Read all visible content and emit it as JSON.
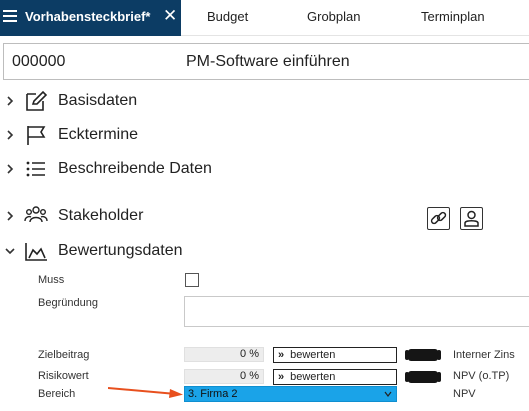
{
  "tabs": {
    "active": "Vorhabensteckbrief*",
    "items": [
      "Budget",
      "Grobplan",
      "Terminplan"
    ]
  },
  "header": {
    "id": "000000",
    "name": "PM-Software einführen"
  },
  "sections": {
    "basisdaten": "Basisdaten",
    "ecktermine": "Ecktermine",
    "beschreibende": "Beschreibende Daten",
    "stakeholder": "Stakeholder",
    "bewertung": "Bewertungsdaten"
  },
  "form": {
    "muss_label": "Muss",
    "begruendung_label": "Begründung",
    "zielbeitrag_label": "Zielbeitrag",
    "zielbeitrag_value": "0 %",
    "risikowert_label": "Risikowert",
    "risikowert_value": "0 %",
    "bereich_label": "Bereich",
    "bereich_value": "3. Firma 2",
    "bewerten_arrow": "»",
    "bewerten_label": "bewerten"
  },
  "right_labels": {
    "interner_zins": "Interner Zins",
    "npv_otp": "NPV (o.TP)",
    "npv": "NPV"
  },
  "colors": {
    "tab_active_bg": "#0c3c64",
    "select_bg": "#1aa3e8",
    "annotation_arrow": "#e8501e"
  }
}
